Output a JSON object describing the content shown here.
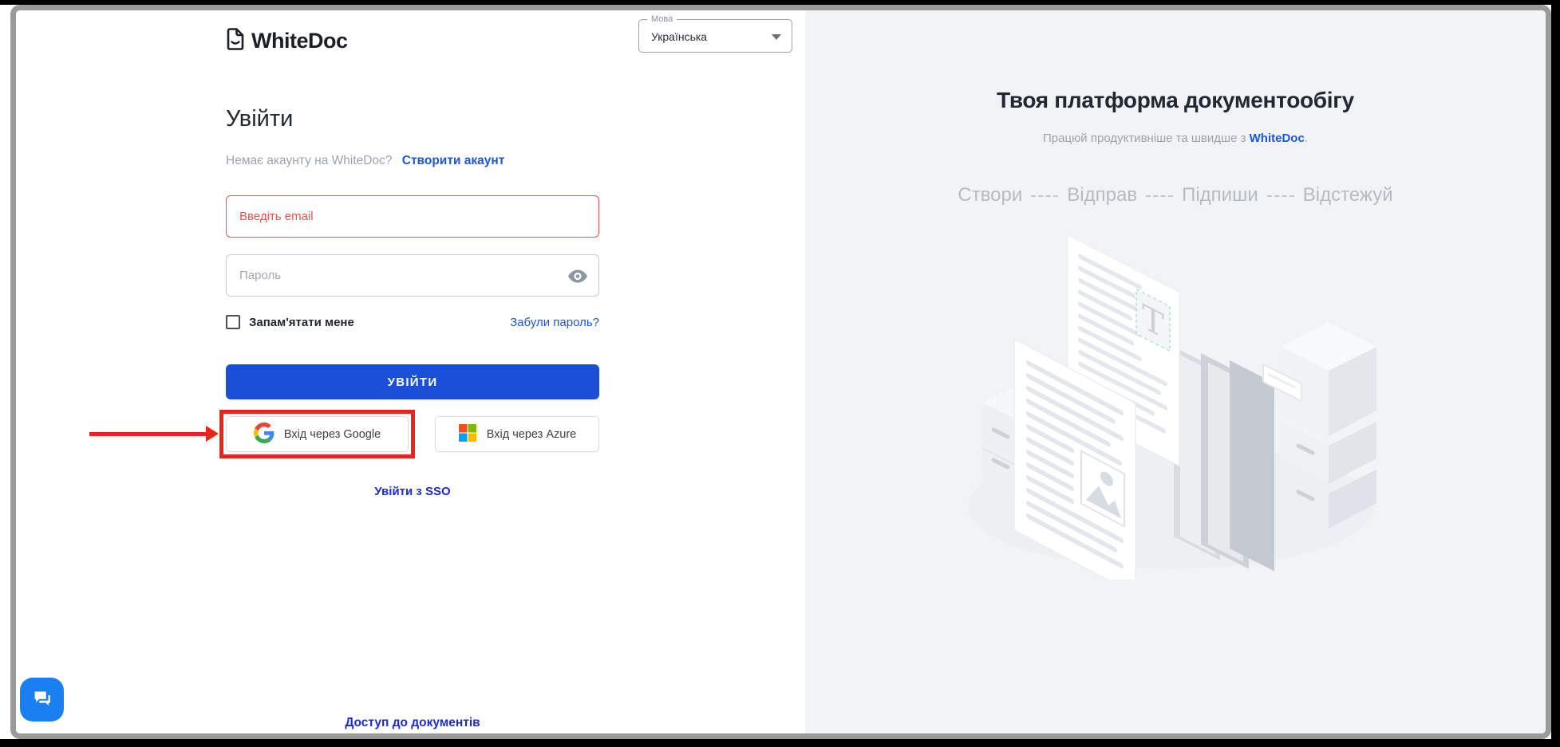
{
  "login": {
    "logo_text": "WhiteDoc",
    "language": {
      "label": "Мова",
      "value": "Українська"
    },
    "title": "Увійти",
    "no_account_text": "Немає акаунту на WhiteDoc?",
    "create_account_link": "Створити акаунт",
    "email_placeholder": "Введіть email",
    "password_placeholder": "Пароль",
    "remember_me_label": "Запам'ятати мене",
    "forgot_password_link": "Забули пароль?",
    "submit_label": "УВІЙТИ",
    "google_button_label": "Вхід через Google",
    "azure_button_label": "Вхід через Azure",
    "sso_link": "Увійти з SSO",
    "docs_access_link": "Доступ до документів"
  },
  "promo": {
    "title": "Твоя платформа документообігу",
    "subtitle_prefix": "Працюй продуктивніше та швидше з ",
    "subtitle_brand": "WhiteDoc",
    "subtitle_suffix": ".",
    "steps": [
      "Створи",
      "Відправ",
      "Підпиши",
      "Відстежуй"
    ]
  },
  "icons": {
    "logo": "document-smile-icon",
    "language_caret": "chevron-down-icon",
    "password_eye": "eye-icon",
    "google": "google-g-icon",
    "azure": "microsoft-icon",
    "chat": "chat-bubbles-icon"
  },
  "annotation": {
    "type": "red-arrow-and-box",
    "target": "google-signin-button"
  },
  "colors": {
    "primary_blue": "#1b4fd8",
    "link_blue": "#1c56db",
    "error_red": "#e8544e",
    "annotation_red": "#e8241c",
    "right_panel_gray": "#f2f3f5",
    "frame_gray": "#9a9a9a",
    "chat_blue": "#1a80f0",
    "muted_text": "#9aa3ad"
  }
}
